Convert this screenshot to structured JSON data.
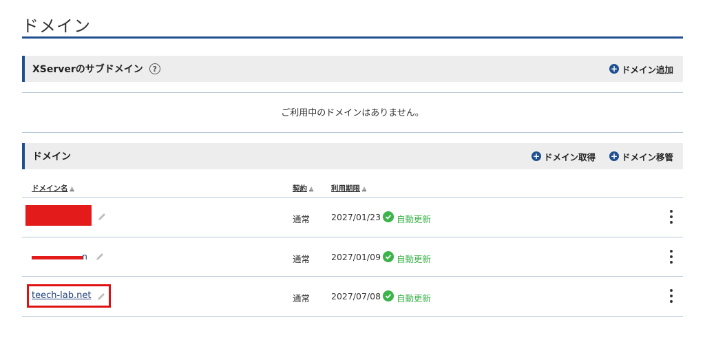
{
  "page": {
    "title": "ドメイン"
  },
  "subdomain_section": {
    "title": "XServerのサブドメイン",
    "help_icon": "?",
    "add_label": "ドメイン追加",
    "empty_message": "ご利用中のドメインはありません。"
  },
  "domain_section": {
    "title": "ドメイン",
    "acquire_label": "ドメイン取得",
    "transfer_label": "ドメイン移管",
    "columns": {
      "name": "ドメイン名",
      "contract": "契約",
      "expiry": "利用期限"
    },
    "rows": [
      {
        "name": "",
        "name_redacted": true,
        "contract": "通常",
        "expiry": "2027/01/23",
        "status": "自動更新"
      },
      {
        "name": "n",
        "name_redacted": true,
        "contract": "通常",
        "expiry": "2027/01/09",
        "status": "自動更新"
      },
      {
        "name": "teech-lab.net",
        "name_redacted": false,
        "highlighted": true,
        "contract": "通常",
        "expiry": "2027/07/08",
        "status": "自動更新"
      }
    ]
  },
  "icons": {
    "help": "question-circle-icon",
    "add": "plus-circle-icon",
    "sort": "sort-icon",
    "edit": "pencil-icon",
    "status": "check-circle-icon",
    "menu": "kebab-menu-icon"
  },
  "colors": {
    "accent": "#1f4f8f",
    "status_green": "#3cb44a",
    "redaction_red": "#e31b1b",
    "highlight_red": "#e01010",
    "header_bg": "#ededed"
  }
}
